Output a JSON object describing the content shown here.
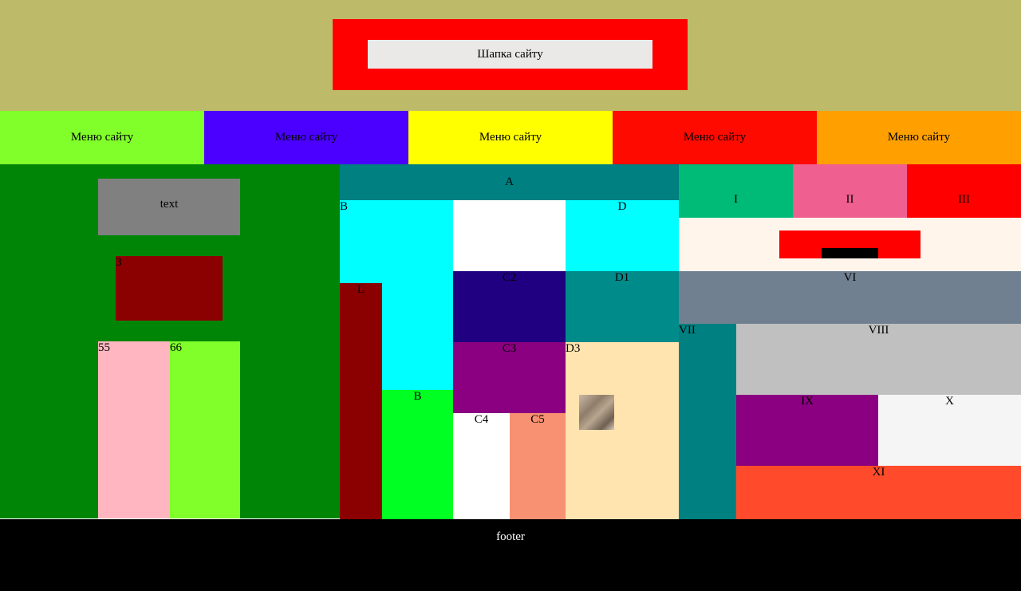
{
  "header": {
    "title": "Шапка сайту"
  },
  "menu": {
    "items": [
      {
        "label": "Меню сайту",
        "color": "#80FF2A"
      },
      {
        "label": "Меню сайту",
        "color": "#4B00FF"
      },
      {
        "label": "Меню сайту",
        "color": "#FFFF00"
      },
      {
        "label": "Меню сайту",
        "color": "#FF0A00"
      },
      {
        "label": "Меню сайту",
        "color": "#FFA000"
      }
    ]
  },
  "left": {
    "text_box": "text",
    "box3": "3",
    "col55": "55",
    "col66": "66"
  },
  "middle": {
    "A": "A",
    "B": "B",
    "L": "L",
    "B2": "B",
    "D": "D",
    "C2": "C2",
    "D1": "D1",
    "C3": "C3",
    "D3": "D3",
    "C4": "C4",
    "C5": "C5"
  },
  "right": {
    "I": "I",
    "II": "II",
    "III": "III",
    "VI": "VI",
    "VII": "VII",
    "VIII": "VIII",
    "IX": "IX",
    "X": "X",
    "XI": "XI"
  },
  "footer": {
    "text": "footer"
  }
}
